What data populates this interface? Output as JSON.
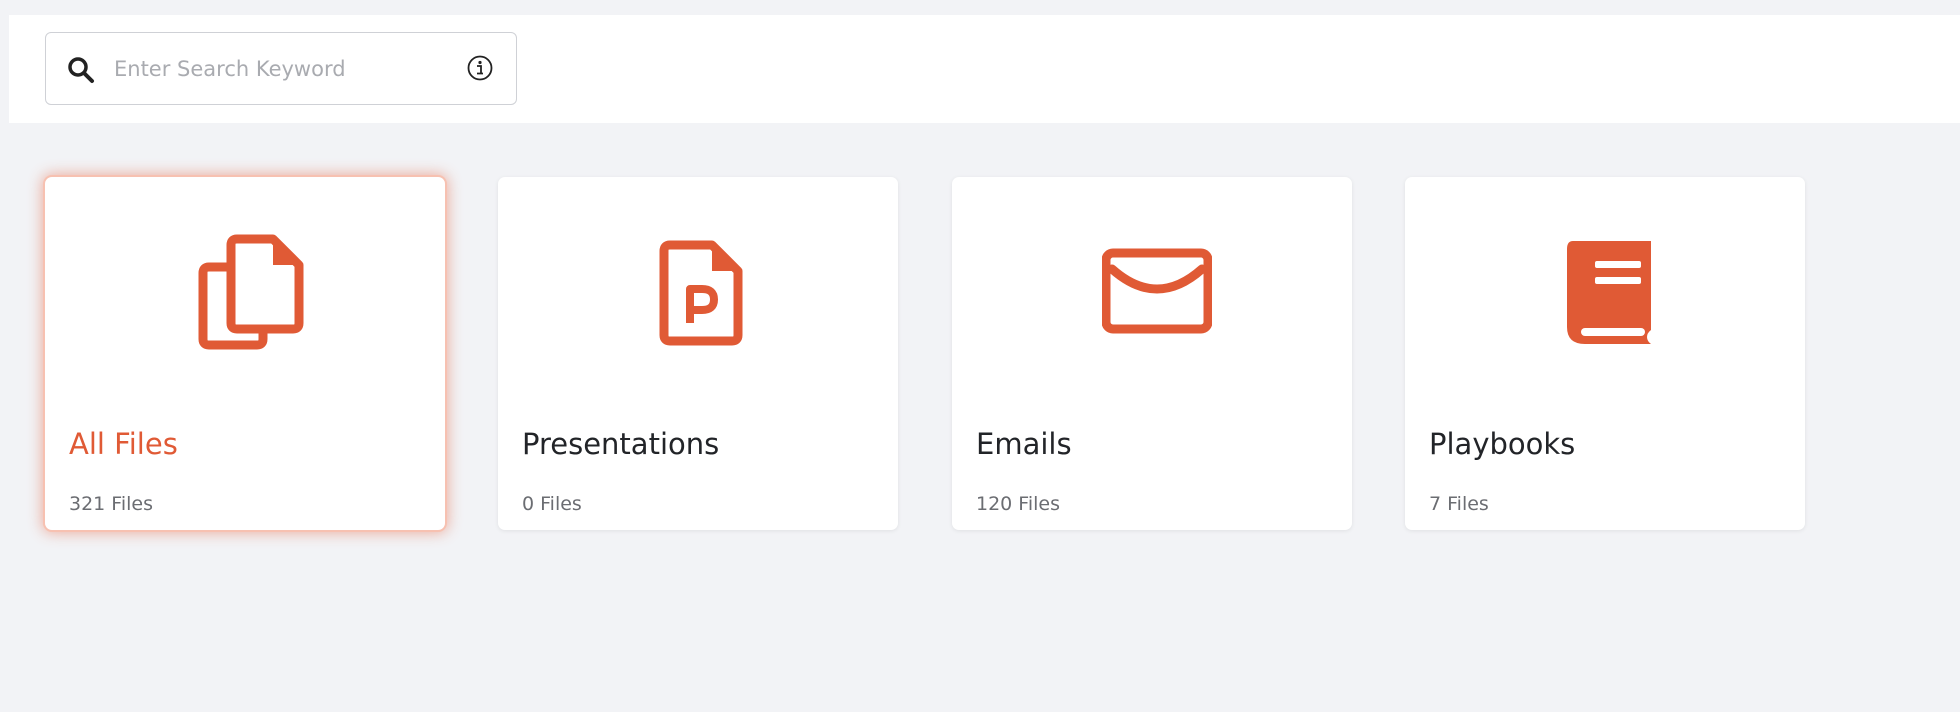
{
  "search": {
    "placeholder": "Enter Search Keyword",
    "value": ""
  },
  "colors": {
    "accent": "#e05a35",
    "background": "#f2f3f6",
    "card": "#ffffff"
  },
  "cards": [
    {
      "title": "All Files",
      "count": "321 Files",
      "icon": "files-copy-icon",
      "selected": true
    },
    {
      "title": "Presentations",
      "count": "0 Files",
      "icon": "presentation-file-icon",
      "selected": false
    },
    {
      "title": "Emails",
      "count": "120 Files",
      "icon": "envelope-icon",
      "selected": false
    },
    {
      "title": "Playbooks",
      "count": "7 Files",
      "icon": "book-icon",
      "selected": false
    }
  ]
}
